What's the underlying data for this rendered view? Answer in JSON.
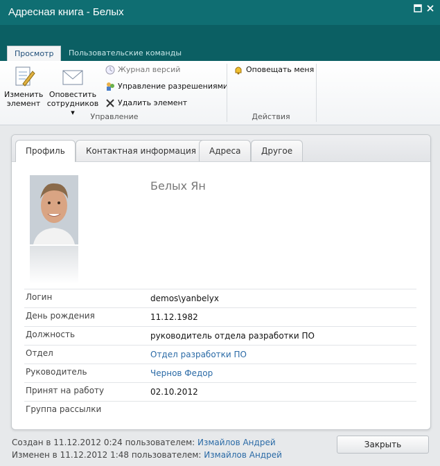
{
  "window": {
    "title": "Адресная книга - Белых"
  },
  "ribbon": {
    "tabs": [
      "Просмотр",
      "Пользовательские команды"
    ],
    "edit_item": "Изменить\nэлемент",
    "notify_staff": "Оповестить\nсотрудников",
    "version_history": "Журнал версий",
    "manage_permissions": "Управление разрешениями",
    "delete_item": "Удалить элемент",
    "alert_me": "Оповещать меня",
    "groups": {
      "manage": "Управление",
      "actions": "Действия"
    }
  },
  "profile": {
    "tabs": [
      "Профиль",
      "Контактная информация",
      "Адреса",
      "Другое"
    ],
    "name": "Белых Ян",
    "fields": [
      {
        "label": "Логин",
        "value": "demos\\yanbelyx"
      },
      {
        "label": "День рождения",
        "value": "11.12.1982"
      },
      {
        "label": "Должность",
        "value": "руководитель отдела разработки ПО"
      },
      {
        "label": "Отдел",
        "value": "Отдел разработки ПО"
      },
      {
        "label": "Руководитель",
        "value": "Чернов Федор"
      },
      {
        "label": "Принят на работу",
        "value": "02.10.2012"
      },
      {
        "label": "Группа рассылки",
        "value": ""
      }
    ]
  },
  "footer": {
    "created_prefix": "Создан в 11.12.2012 0:24 пользователем:",
    "created_by": "Измайлов Андрей",
    "modified_prefix": "Изменен в 11.12.2012 1:48 пользователем:",
    "modified_by": "Измайлов Андрей",
    "close": "Закрыть"
  }
}
